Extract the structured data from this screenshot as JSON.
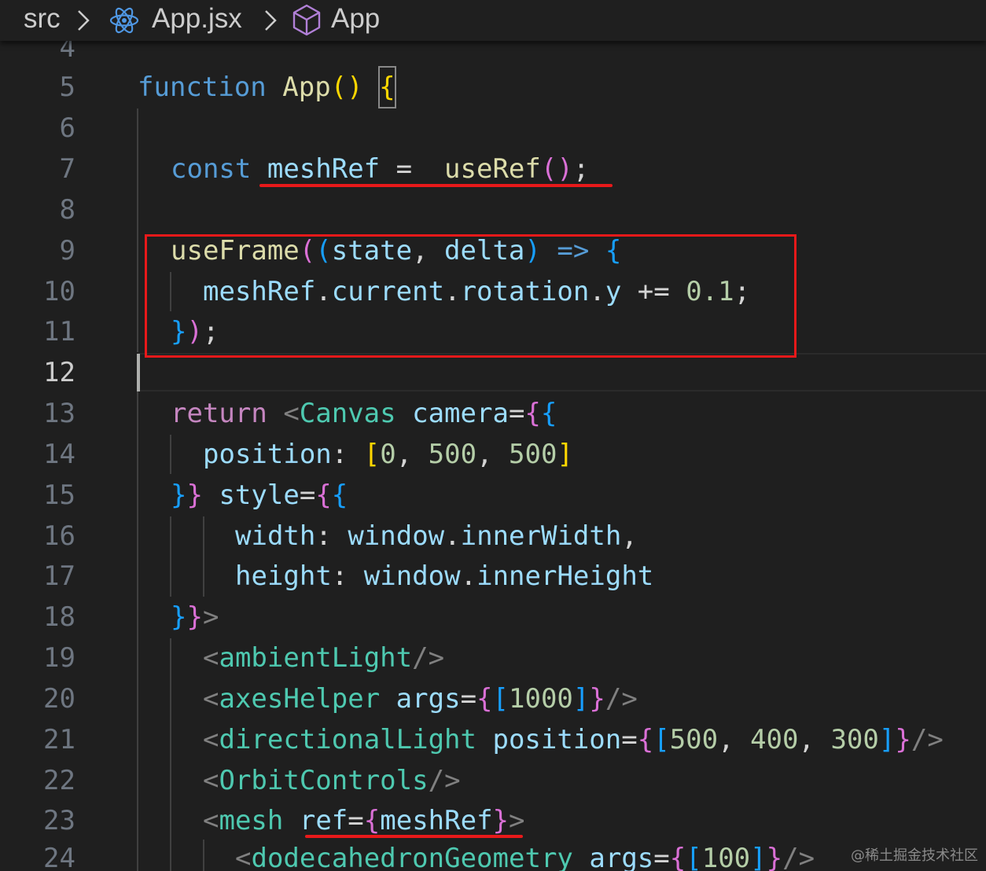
{
  "breadcrumb": {
    "folder": "src",
    "separator": ">",
    "file": "App.jsx",
    "symbol": "App",
    "file_icon": "react-icon",
    "symbol_icon": "cube-icon"
  },
  "editor": {
    "active_line": "12",
    "line_numbers": [
      "4",
      "5",
      "6",
      "7",
      "8",
      "9",
      "10",
      "11",
      "12",
      "13",
      "14",
      "15",
      "16",
      "17",
      "18",
      "19",
      "20",
      "21",
      "22",
      "23",
      "24"
    ],
    "code": {
      "l5": {
        "kw": "function",
        "name": "App",
        "paren": "()",
        "brace": "{"
      },
      "l7": {
        "kw": "const",
        "var": "meshRef",
        "eq": " = ",
        "fn": "useRef",
        "call": "()",
        "semi": ";"
      },
      "l9": {
        "fn": "useFrame",
        "p1": "(",
        "p2": "(",
        "a1": "state",
        "comma": ", ",
        "a2": "delta",
        "p3": ")",
        "arrow": "=>",
        "brace": "{"
      },
      "l10": {
        "obj": "meshRef",
        "dot1": ".",
        "p1": "current",
        "dot2": ".",
        "p2": "rotation",
        "dot3": ".",
        "p3": "y",
        "op": " += ",
        "num": "0.1",
        "semi": ";"
      },
      "l11": {
        "brace": "}",
        "paren": ")",
        "semi": ";"
      },
      "l13": {
        "kw": "return",
        "lt": "<",
        "tag": "Canvas",
        "attr": "camera",
        "eq": "=",
        "b1": "{",
        "b2": "{"
      },
      "l14": {
        "prop": "position",
        "colon": ": ",
        "lb": "[",
        "n1": "0",
        "c1": ", ",
        "n2": "500",
        "c2": ", ",
        "n3": "500",
        "rb": "]"
      },
      "l15": {
        "b1": "}",
        "b2": "}",
        "attr": "style",
        "eq": "=",
        "b3": "{",
        "b4": "{"
      },
      "l16": {
        "prop": "width",
        "colon": ": ",
        "obj": "window",
        "dot": ".",
        "val": "innerWidth",
        "comma": ","
      },
      "l17": {
        "prop": "height",
        "colon": ": ",
        "obj": "window",
        "dot": ".",
        "val": "innerHeight"
      },
      "l18": {
        "b1": "}",
        "b2": "}",
        "gt": ">"
      },
      "l19": {
        "lt": "<",
        "tag": "ambientLight",
        "end": "/>"
      },
      "l20": {
        "lt": "<",
        "tag": "axesHelper",
        "attr": "args",
        "eq": "=",
        "b1": "{",
        "lb": "[",
        "n": "1000",
        "rb": "]",
        "b2": "}",
        "end": "/>"
      },
      "l21": {
        "lt": "<",
        "tag": "directionalLight",
        "attr": "position",
        "eq": "=",
        "b1": "{",
        "lb": "[",
        "n1": "500",
        "c1": ", ",
        "n2": "400",
        "c2": ", ",
        "n3": "300",
        "rb": "]",
        "b2": "}",
        "end": "/>"
      },
      "l22": {
        "lt": "<",
        "tag": "OrbitControls",
        "end": "/>"
      },
      "l23": {
        "lt": "<",
        "tag": "mesh",
        "attr": "ref",
        "eq": "=",
        "b1": "{",
        "val": "meshRef",
        "b2": "}",
        "gt": ">"
      },
      "l24": {
        "lt": "<",
        "tag": "dodecahedronGeometry",
        "attr": "args",
        "eq": "=",
        "b1": "{",
        "lb": "[",
        "n": "100",
        "rb": "]",
        "b2": "}",
        "end": "/>"
      }
    }
  },
  "annotations": {
    "highlight_color": "#e8191a"
  },
  "watermark": "@稀土掘金技术社区"
}
